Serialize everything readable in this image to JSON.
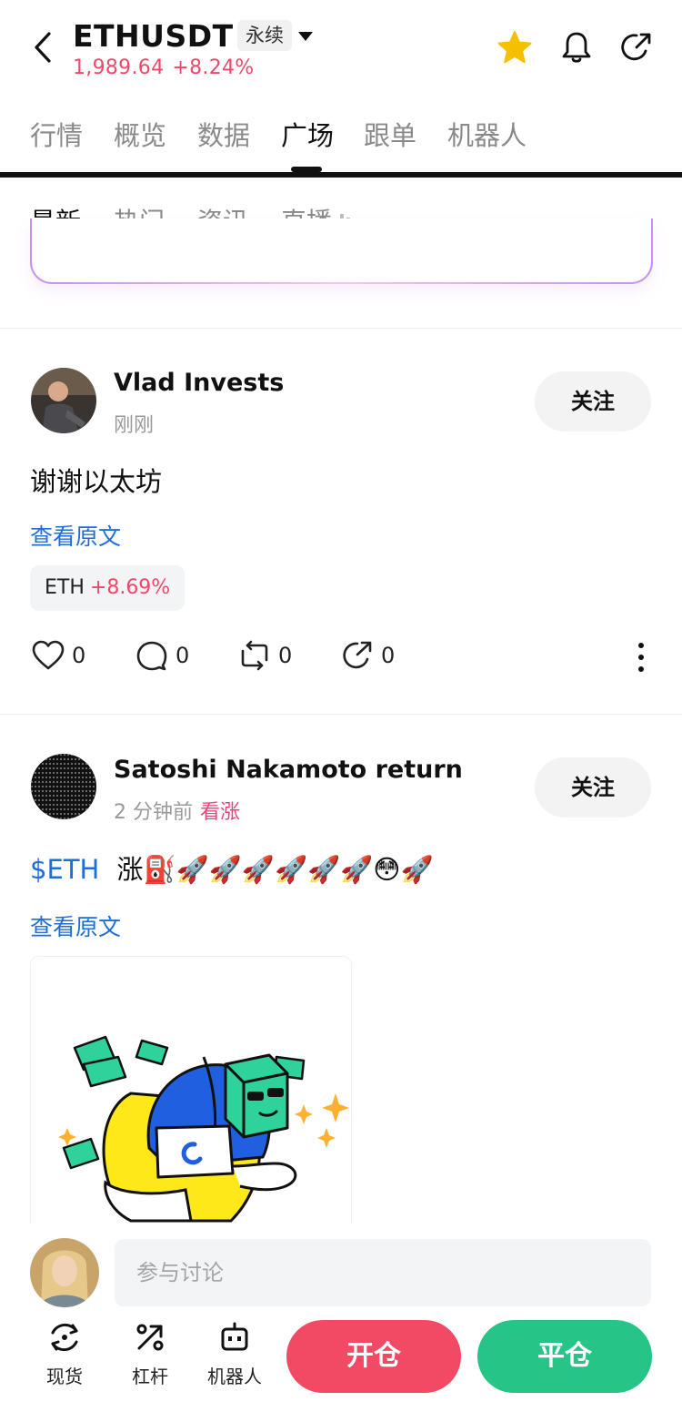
{
  "header": {
    "symbol": "ETHUSDT",
    "contract_type": "永续",
    "price": "1,989.64",
    "change": "+8.24%"
  },
  "tabs": [
    {
      "label": "行情",
      "active": false
    },
    {
      "label": "概览",
      "active": false
    },
    {
      "label": "数据",
      "active": false
    },
    {
      "label": "广场",
      "active": true
    },
    {
      "label": "跟单",
      "active": false
    },
    {
      "label": "机器人",
      "active": false
    }
  ],
  "subtabs": [
    {
      "label": "最新",
      "active": true
    },
    {
      "label": "热门",
      "active": false
    },
    {
      "label": "资讯",
      "active": false
    },
    {
      "label": "直播",
      "active": false
    }
  ],
  "posts": [
    {
      "author": "Vlad Invests",
      "time": "刚刚",
      "follow_label": "关注",
      "text": "谢谢以太坊",
      "view_original": "查看原文",
      "ticker": {
        "name": "ETH",
        "change": "+8.69%"
      },
      "actions": {
        "likes": "0",
        "comments": "0",
        "reposts": "0",
        "shares": "0"
      }
    },
    {
      "author": "Satoshi Nakamoto return",
      "time": "2 分钟前",
      "sentiment": "看涨",
      "follow_label": "关注",
      "cashtag": "$ETH",
      "text": "涨⛽️🚀🚀🚀🚀🚀🚀😳🚀",
      "view_original": "查看原文"
    }
  ],
  "composer": {
    "placeholder": "参与讨论"
  },
  "bottom_nav": [
    {
      "label": "现货",
      "icon": "spot-icon"
    },
    {
      "label": "杠杆",
      "icon": "leverage-icon"
    },
    {
      "label": "机器人",
      "icon": "robot-icon"
    }
  ],
  "buttons": {
    "open": "开仓",
    "close": "平仓"
  },
  "colors": {
    "up": "#f0486a",
    "link": "#1f6ed8",
    "open_btn": "#f24a65",
    "close_btn": "#26c487",
    "favorite": "#f5c000"
  }
}
